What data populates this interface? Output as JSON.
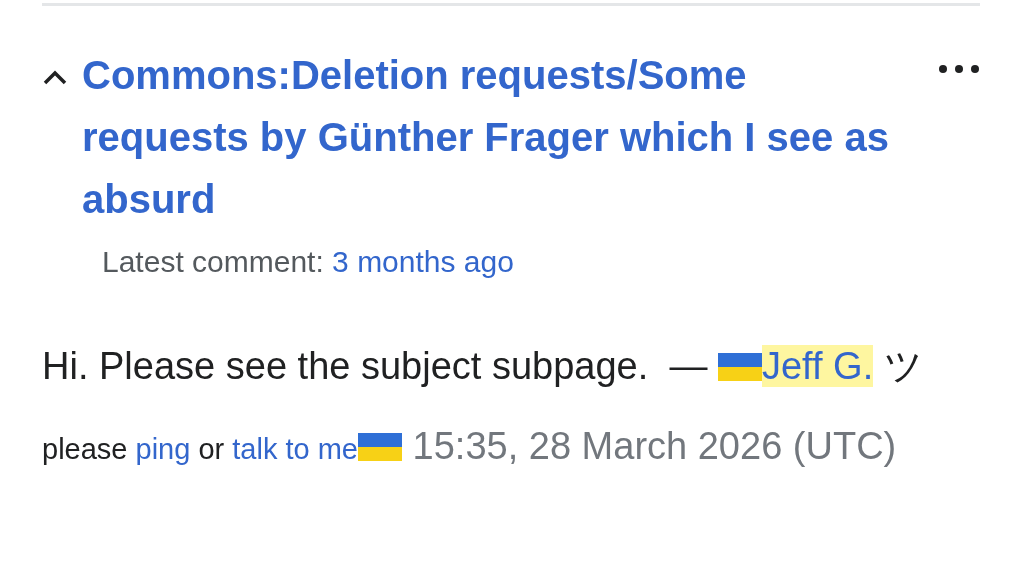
{
  "thread": {
    "expanded": true,
    "title": "Commons:Deletion requests/Some requests by Günther Frager which I see as absurd",
    "latest_label": "Latest comment:",
    "latest_link": "3 months ago"
  },
  "comment": {
    "text": "Hi. Please see the subject subpage.",
    "dash": "—",
    "user": "Jeff G.",
    "user_highlighted": true,
    "smiley": "ツ",
    "please": "please",
    "ping": "ping",
    "or": "or",
    "talk": "talk to me",
    "timestamp": "15:35, 28 March 2026 (UTC)"
  }
}
